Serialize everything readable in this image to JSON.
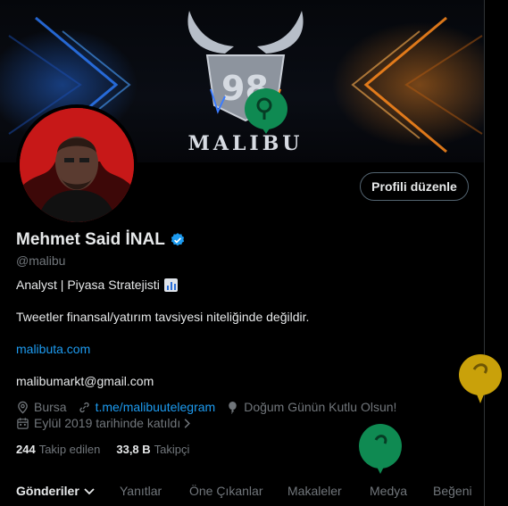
{
  "banner": {
    "brand": "MALIBU"
  },
  "profile": {
    "edit_button": "Profili düzenle",
    "name": "Mehmet Said İNAL",
    "handle": "@malibu",
    "bio_line1": "Analyst | Piyasa Stratejisti",
    "bio_line2": "Tweetler finansal/yatırım tavsiyesi niteliğinde değildir.",
    "website": "malibuta.com",
    "email": "malibumarkt@gmail.com",
    "location": "Bursa",
    "telegram": "t.me/malibuutelegram",
    "birthday": "Doğum Günün Kutlu Olsun!",
    "joined": "Eylül 2019 tarihinde katıldı"
  },
  "counts": {
    "following_value": "244",
    "following_label": "Takip edilen",
    "followers_value": "33,8 B",
    "followers_label": "Takipçi"
  },
  "tabs": [
    "Gönderiler",
    "Yanıtlar",
    "Öne Çıkanlar",
    "Makaleler",
    "Medya",
    "Beğeni"
  ],
  "icons": {
    "verified": "verified-badge-icon",
    "location": "location-pin-icon",
    "link": "link-icon",
    "birthday": "balloon-icon",
    "calendar": "calendar-icon"
  },
  "colors": {
    "accent": "#1d9bf0",
    "balloon_green": "#0f8a52",
    "balloon_gold": "#c9a10a"
  }
}
